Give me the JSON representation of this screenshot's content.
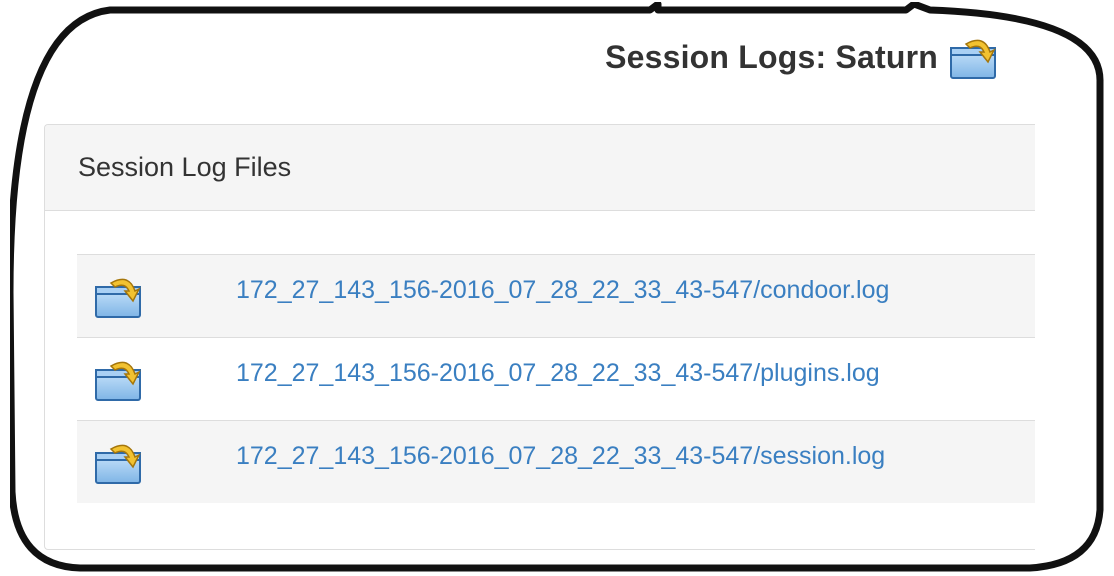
{
  "page": {
    "title": "Session Logs: Saturn",
    "title_icon": "folder-arrow-icon"
  },
  "panel": {
    "title": "Session Log Files",
    "files": [
      {
        "name": "172_27_143_156-2016_07_28_22_33_43-547/condoor.log",
        "icon": "folder-arrow-icon"
      },
      {
        "name": "172_27_143_156-2016_07_28_22_33_43-547/plugins.log",
        "icon": "folder-arrow-icon"
      },
      {
        "name": "172_27_143_156-2016_07_28_22_33_43-547/session.log",
        "icon": "folder-arrow-icon"
      }
    ]
  },
  "colors": {
    "link": "#3a7fc1",
    "heading_bg": "#f5f5f5",
    "border": "#dddddd",
    "text": "#333333"
  }
}
